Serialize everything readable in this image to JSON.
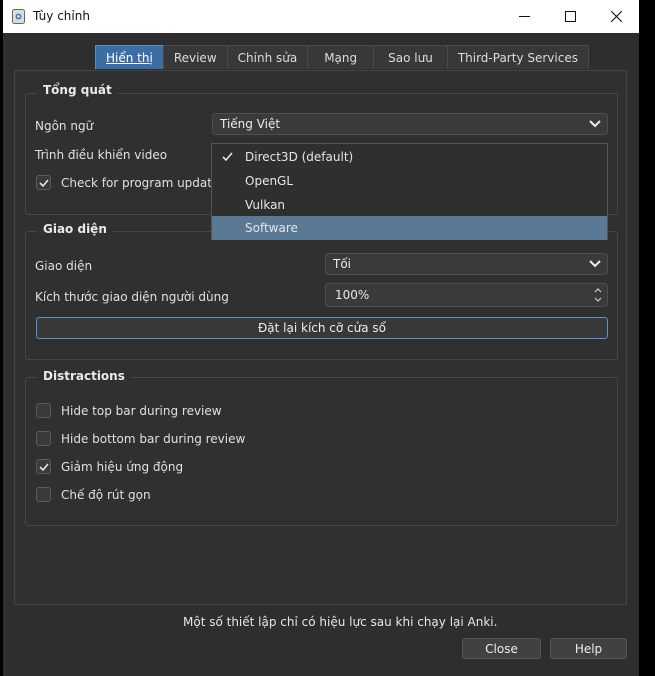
{
  "window": {
    "title": "Tùy chỉnh"
  },
  "tabs": [
    {
      "label": "Hiển thị",
      "active": true
    },
    {
      "label": "Review"
    },
    {
      "label": "Chỉnh sửa"
    },
    {
      "label": "Mạng"
    },
    {
      "label": "Sao lưu"
    },
    {
      "label": "Third-Party Services"
    }
  ],
  "general": {
    "title": "Tổng quát",
    "language_label": "Ngôn ngữ",
    "language_value": "Tiếng Việt",
    "video_driver_label": "Trình điều khiển video",
    "check_updates_label": "Check for program updates",
    "check_updates_checked": true
  },
  "video_dropdown": {
    "options": [
      "Direct3D (default)",
      "OpenGL",
      "Vulkan",
      "Software"
    ],
    "checked": "Direct3D (default)",
    "highlighted": "Software"
  },
  "appearance": {
    "title": "Giao diện",
    "theme_label": "Giao diện",
    "theme_value": "Tối",
    "ui_size_label": "Kích thước giao diện người dùng",
    "ui_size_value": "100%",
    "reset_button": "Đặt lại kích cỡ cửa sổ"
  },
  "distractions": {
    "title": "Distractions",
    "items": [
      {
        "label": "Hide top bar during review",
        "checked": false
      },
      {
        "label": "Hide bottom bar during review",
        "checked": false
      },
      {
        "label": "Giảm hiệu ứng động",
        "checked": true
      },
      {
        "label": "Chế độ rút gọn",
        "checked": false
      }
    ]
  },
  "footer": {
    "note": "Một số thiết lập chỉ có hiệu lực sau khi chạy lại Anki.",
    "close_button": "Close",
    "help_button": "Help"
  },
  "colors": {
    "accent": "#3c6ea6",
    "highlight": "#5a7994",
    "background": "#2e2e2e"
  }
}
